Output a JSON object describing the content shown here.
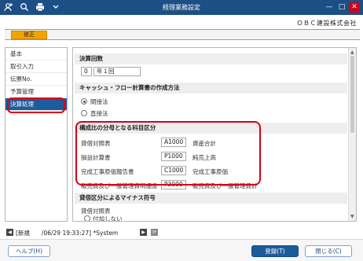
{
  "window": {
    "title": "経理業務設定",
    "icons": [
      "add-user-icon",
      "search-icon",
      "print-icon",
      "menu-icon"
    ],
    "minimize": "—",
    "maximize": "□",
    "close": "✕"
  },
  "company_name": "ＯＢＣ建設株式会社",
  "mode_label": "修正",
  "sidebar": {
    "items": [
      {
        "label": "基本"
      },
      {
        "label": "取引入力"
      },
      {
        "label": "伝票No."
      },
      {
        "label": "予算管理"
      },
      {
        "label": "決算処理"
      }
    ],
    "active_index": 4
  },
  "sections": {
    "settlement_count": {
      "title": "決算回数",
      "value": "0",
      "unit": "年１回"
    },
    "cashflow": {
      "title": "キャッシュ・フロー計算書の作成方法",
      "options": [
        "間接法",
        "直接法"
      ],
      "selected": "間接法"
    },
    "components": {
      "title": "構成比の分母となる科目区分",
      "rows": [
        {
          "label": "貸借対照表",
          "code": "A1000",
          "name": "資産合計"
        },
        {
          "label": "損益計算書",
          "code": "P1000",
          "name": "純売上高"
        },
        {
          "label": "完成工事原価報告書",
          "code": "C1000",
          "name": "完成工事原価"
        },
        {
          "label": "販売費及び一般管理費明細書",
          "code": "P3000",
          "name": "販売費及び一般管理費計"
        }
      ]
    },
    "minus_sign": {
      "title": "貸借区分によるマイナス符号",
      "sub_label": "貸借対照表",
      "option": "付加しない"
    }
  },
  "statusbar": {
    "text": "[新規　　/06/29 19:33:27] *System"
  },
  "buttons": {
    "help": "ヘルプ(H)",
    "register": "登録(T)",
    "close": "閉じる(C)"
  }
}
